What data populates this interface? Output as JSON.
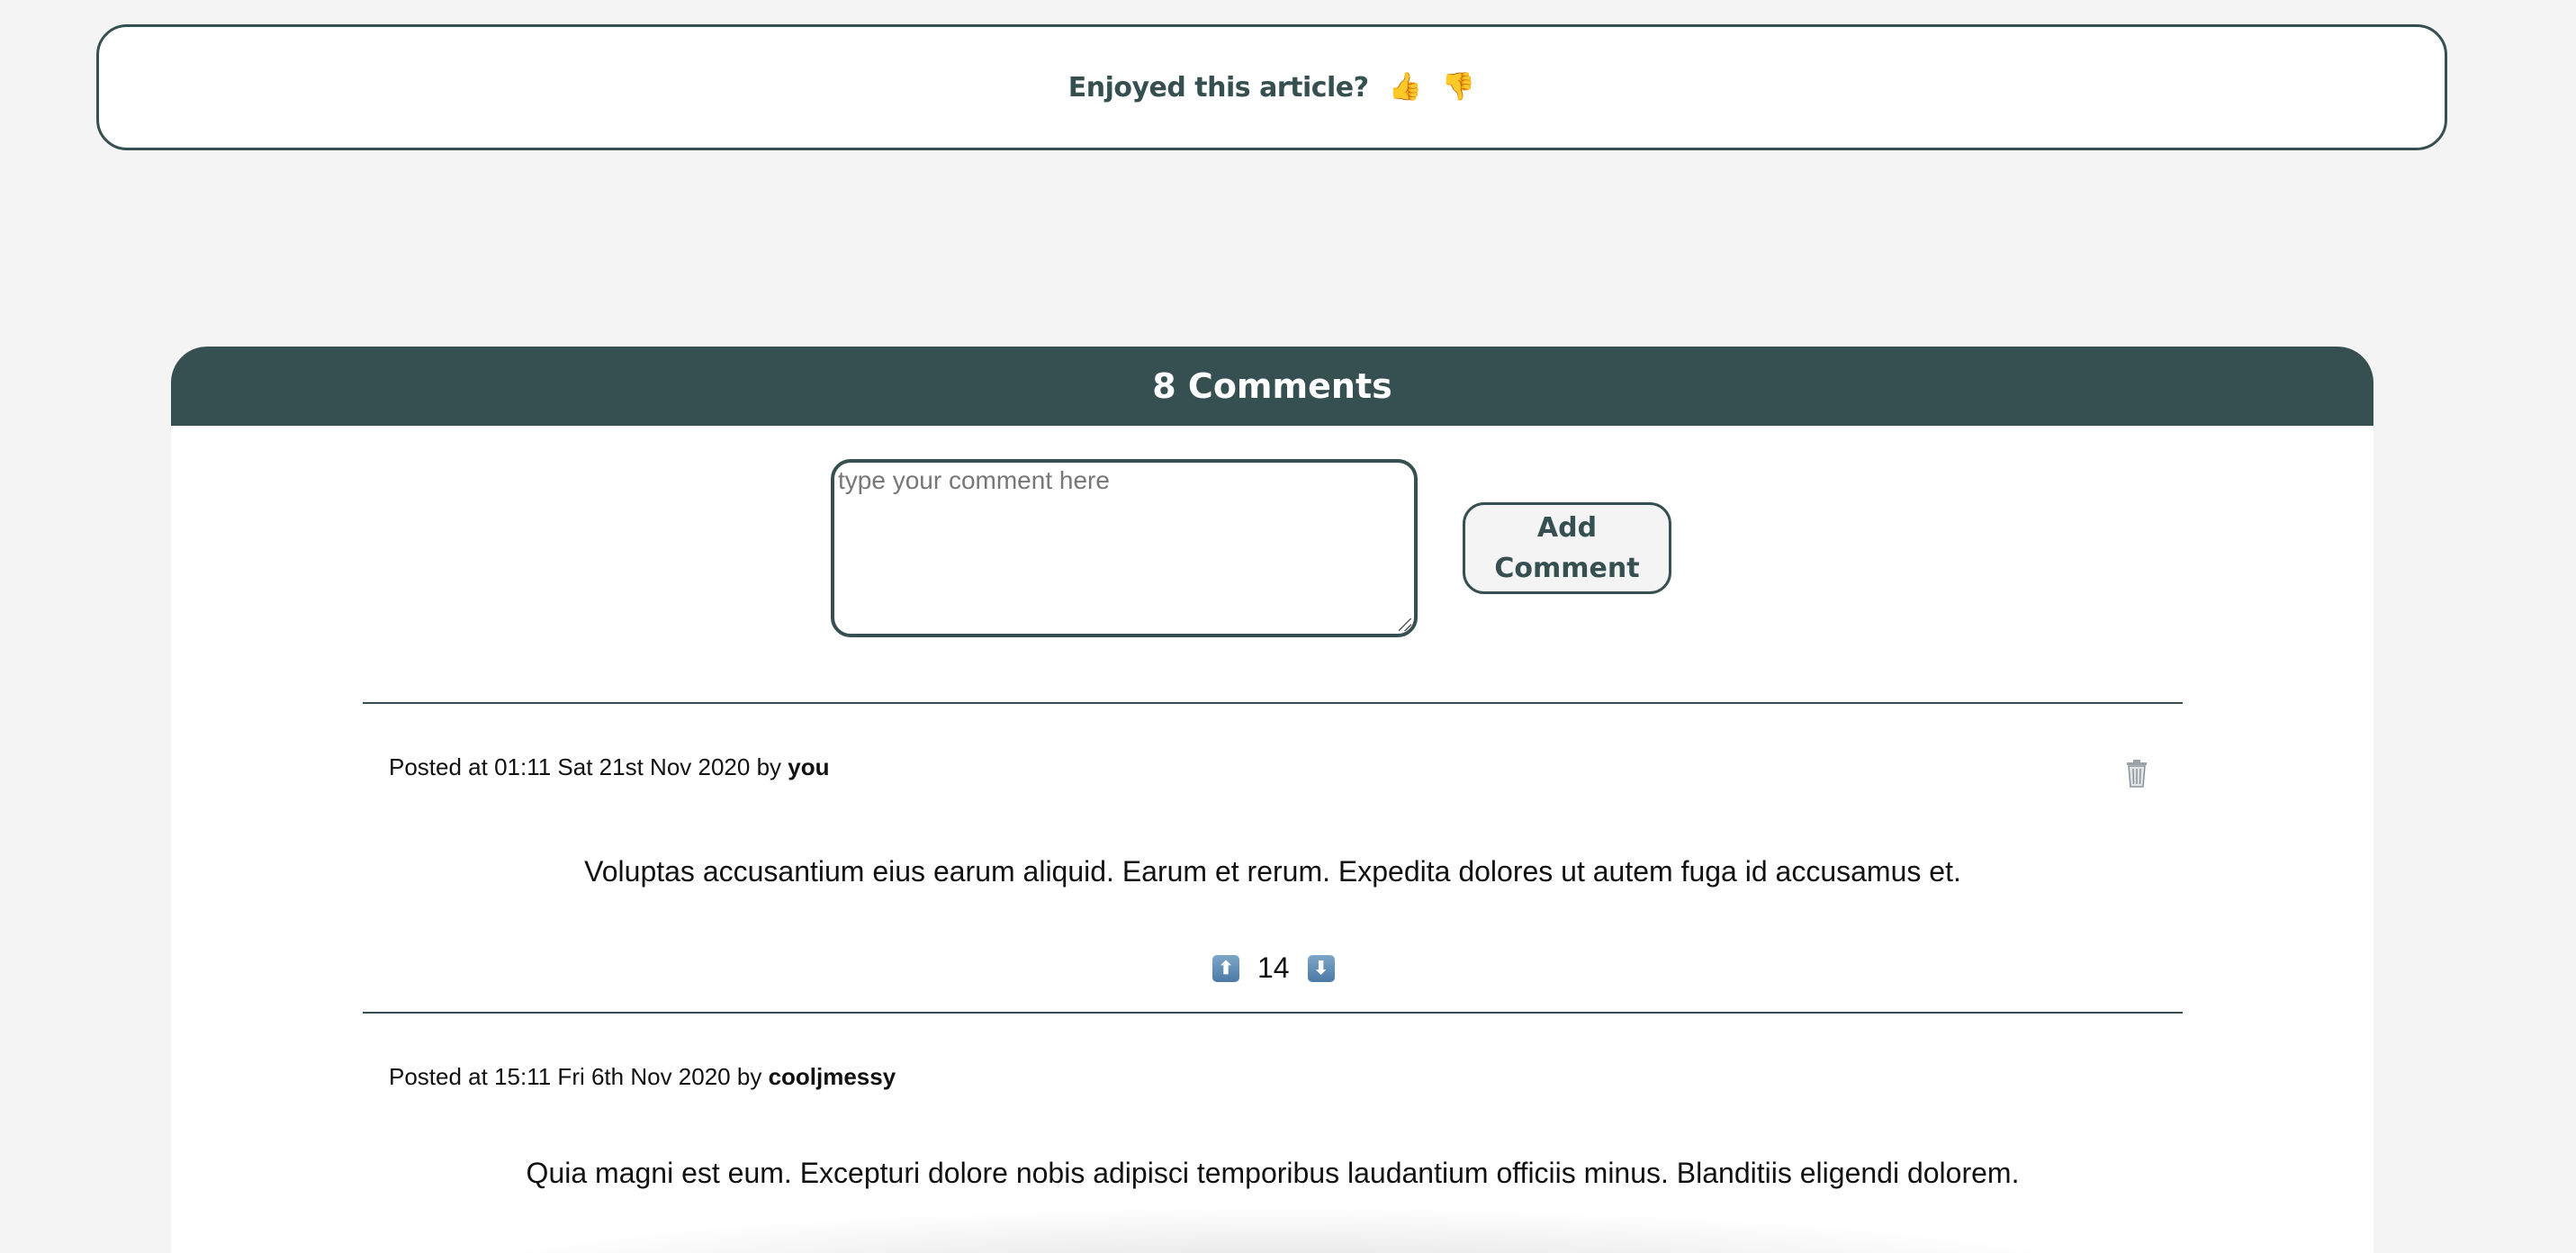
{
  "feedback": {
    "question": "Enjoyed this article?",
    "thumbs_up": "👍",
    "thumbs_down": "👎"
  },
  "comments_section": {
    "title": "8 Comments",
    "input_placeholder": "type your comment here",
    "add_button_label_line1": "Add",
    "add_button_label_line2": "Comment",
    "comments": [
      {
        "meta_prefix": "Posted at 01:11 Sat 21st Nov 2020 by ",
        "author": "you",
        "body": "Voluptas accusantium eius earum aliquid. Earum et rerum. Expedita dolores ut autem fuga id accusamus et.",
        "votes": "14",
        "up_icon": "⬆",
        "down_icon": "⬇"
      },
      {
        "meta_prefix": "Posted at 15:11 Fri 6th Nov 2020 by ",
        "author": "cooljmessy",
        "body": "Quia magni est eum. Excepturi dolore nobis adipisci temporibus laudantium officiis minus. Blanditiis eligendi dolorem."
      }
    ]
  }
}
